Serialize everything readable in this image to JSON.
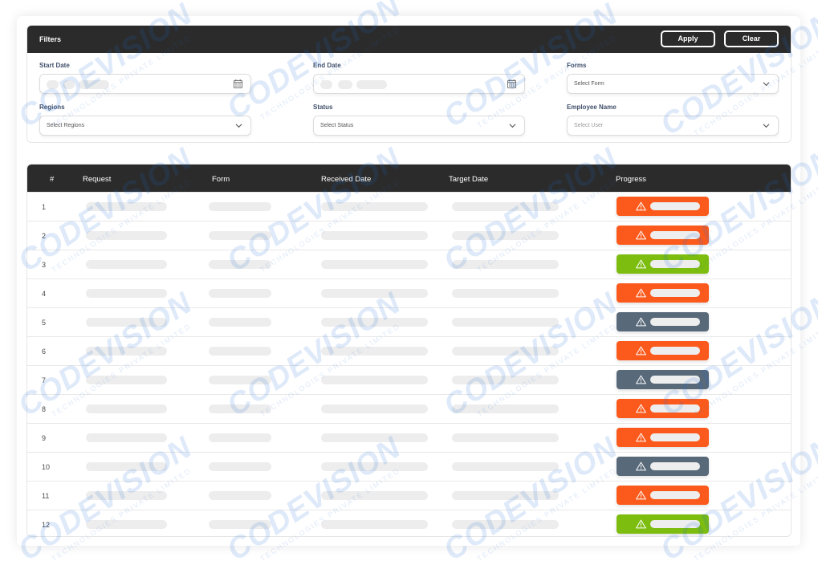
{
  "filters": {
    "title": "Filters",
    "apply_label": "Apply",
    "clear_label": "Clear",
    "start_date": {
      "label": "Start Date"
    },
    "end_date": {
      "label": "End Date"
    },
    "forms": {
      "label": "Forms",
      "value": "Select Form"
    },
    "regions": {
      "label": "Regions",
      "value": "Select Regions"
    },
    "status": {
      "label": "Status",
      "value": "Select Status"
    },
    "employee": {
      "label": "Employee Name",
      "placeholder": "Select User"
    }
  },
  "table": {
    "columns": [
      "#",
      "Request",
      "Form",
      "Received Date",
      "Target Date",
      "Progress"
    ],
    "rows": [
      {
        "num": "1",
        "status_color": "#fb5a1c"
      },
      {
        "num": "2",
        "status_color": "#fb5a1c"
      },
      {
        "num": "3",
        "status_color": "#7cbd0f"
      },
      {
        "num": "4",
        "status_color": "#fb5a1c"
      },
      {
        "num": "5",
        "status_color": "#58697a"
      },
      {
        "num": "6",
        "status_color": "#fb5a1c"
      },
      {
        "num": "7",
        "status_color": "#58697a"
      },
      {
        "num": "8",
        "status_color": "#fb5a1c"
      },
      {
        "num": "9",
        "status_color": "#fb5a1c"
      },
      {
        "num": "10",
        "status_color": "#58697a"
      },
      {
        "num": "11",
        "status_color": "#fb5a1c"
      },
      {
        "num": "12",
        "status_color": "#7cbd0f"
      }
    ],
    "progress_icon": "warning-triangle-icon"
  },
  "watermark": {
    "main": "CODEVISION",
    "sub": "TECHNOLOGIES PRIVATE LIMITED"
  },
  "colors": {
    "header_bg": "#2b2b2b",
    "label": "#3f4f6a",
    "danger": "#fb5a1c",
    "success": "#7cbd0f",
    "neutral": "#58697a"
  }
}
